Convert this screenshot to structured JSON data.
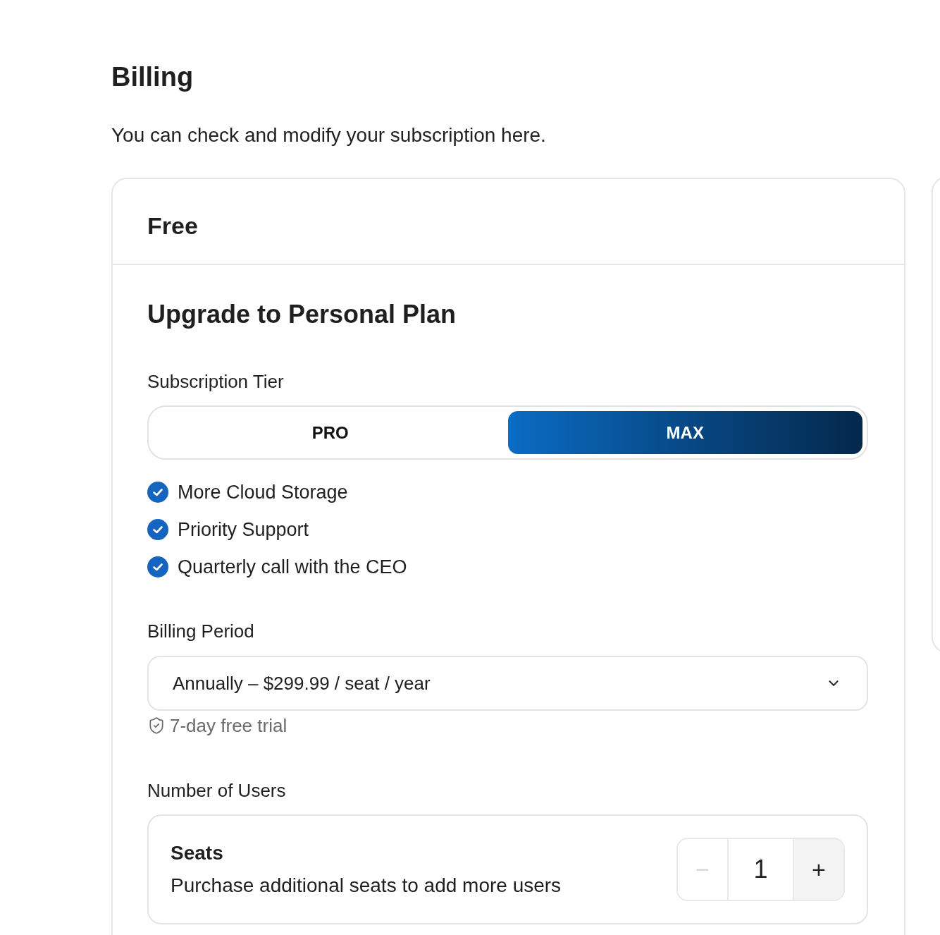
{
  "page": {
    "title": "Billing",
    "subtitle": "You can check and modify your subscription here."
  },
  "plan_card": {
    "current_plan": "Free",
    "heading": "Upgrade to Personal Plan",
    "tier": {
      "label": "Subscription Tier",
      "options": [
        {
          "label": "PRO",
          "selected": false
        },
        {
          "label": "MAX",
          "selected": true
        }
      ]
    },
    "features": [
      {
        "label": "More Cloud Storage",
        "checked": true
      },
      {
        "label": "Priority Support",
        "checked": true
      },
      {
        "label": "Quarterly call with the CEO",
        "checked": true
      }
    ],
    "billing_period": {
      "label": "Billing Period",
      "value": "Annually – $299.99 / seat / year",
      "note": "7-day free trial"
    },
    "users": {
      "label": "Number of Users",
      "seats": {
        "title": "Seats",
        "description": "Purchase additional seats to add more users",
        "value": "1",
        "decrement": {
          "label": "−",
          "disabled": true
        },
        "increment": {
          "label": "+",
          "disabled": false
        }
      }
    }
  }
}
